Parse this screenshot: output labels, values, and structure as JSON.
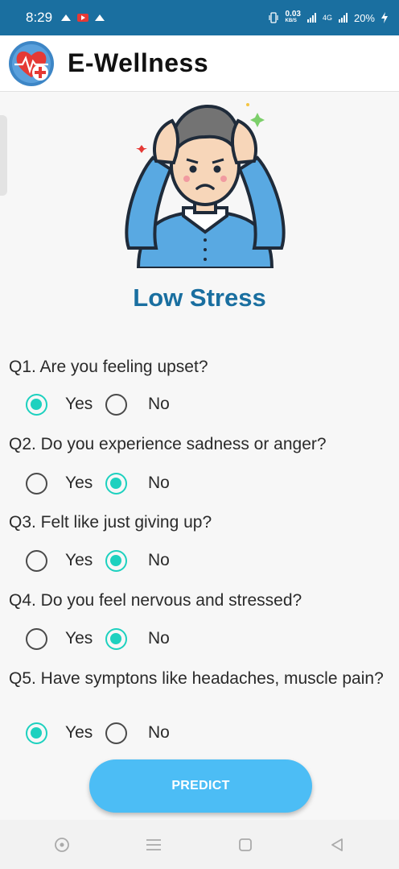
{
  "status_bar": {
    "time": "8:29",
    "speed": "0.03",
    "speed_unit": "KB/S",
    "network": "4G",
    "battery": "20%"
  },
  "app": {
    "title": "E-Wellness"
  },
  "result": {
    "title": "Low Stress"
  },
  "questions": [
    {
      "text": "Q1. Are you feeling upset?",
      "yes_label": "Yes",
      "no_label": "No",
      "selected": "Yes"
    },
    {
      "text": "Q2. Do you experience sadness or anger?",
      "yes_label": "Yes",
      "no_label": "No",
      "selected": "No"
    },
    {
      "text": "Q3. Felt like just giving up?",
      "yes_label": "Yes",
      "no_label": "No",
      "selected": "No"
    },
    {
      "text": "Q4. Do you feel nervous and stressed?",
      "yes_label": "Yes",
      "no_label": "No",
      "selected": "No"
    },
    {
      "text": "Q5. Have symptons like headaches, muscle pain?",
      "yes_label": "Yes",
      "no_label": "No",
      "selected": "Yes"
    }
  ],
  "predict_button": {
    "label": "PREDICT"
  },
  "colors": {
    "accent": "#1a6fa0",
    "radio_checked": "#1dd1bf",
    "button": "#4cbdf5"
  }
}
